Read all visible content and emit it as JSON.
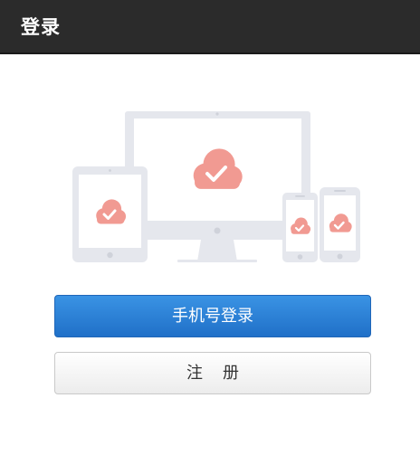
{
  "header": {
    "title": "登录"
  },
  "illustration": {
    "icon": "multi-device-cloud-sync-icon",
    "colors": {
      "device": "#e4e6ec",
      "cloud": "#f19a92"
    }
  },
  "actions": {
    "phone_login_label": "手机号登录",
    "register_label": "注册"
  },
  "colors": {
    "header_bg": "#2b2b2b",
    "primary": "#2a7fd4"
  }
}
